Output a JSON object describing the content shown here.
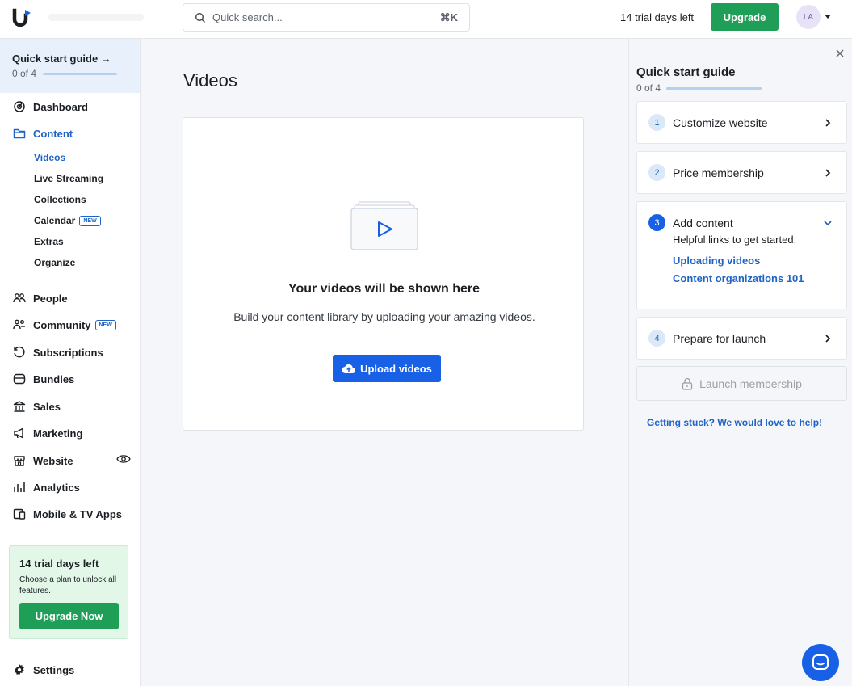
{
  "header": {
    "search_placeholder": "Quick search...",
    "search_shortcut": "⌘K",
    "trial_text": "14 trial days left",
    "upgrade_label": "Upgrade",
    "avatar_initials": "LA"
  },
  "sidebar": {
    "quick_start": {
      "title": "Quick start guide →",
      "progress": "0 of 4"
    },
    "nav": [
      {
        "label": "Dashboard",
        "icon": "dashboard-icon"
      },
      {
        "label": "Content",
        "icon": "folder-icon",
        "active": true
      },
      {
        "label": "People",
        "icon": "people-icon"
      },
      {
        "label": "Community",
        "icon": "community-icon",
        "badge": "NEW"
      },
      {
        "label": "Subscriptions",
        "icon": "refresh-icon"
      },
      {
        "label": "Bundles",
        "icon": "bundle-icon"
      },
      {
        "label": "Sales",
        "icon": "bank-icon"
      },
      {
        "label": "Marketing",
        "icon": "megaphone-icon"
      },
      {
        "label": "Website",
        "icon": "storefront-icon"
      },
      {
        "label": "Analytics",
        "icon": "analytics-icon"
      },
      {
        "label": "Mobile & TV Apps",
        "icon": "devices-icon"
      }
    ],
    "content_sub": [
      {
        "label": "Videos",
        "active": true
      },
      {
        "label": "Live Streaming"
      },
      {
        "label": "Collections"
      },
      {
        "label": "Calendar",
        "badge": "NEW"
      },
      {
        "label": "Extras"
      },
      {
        "label": "Organize"
      }
    ],
    "trial_card": {
      "title": "14 trial days left",
      "desc": "Choose a plan to unlock all features.",
      "button": "Upgrade Now"
    },
    "settings_label": "Settings"
  },
  "main": {
    "title": "Videos",
    "empty": {
      "title": "Your videos will be shown here",
      "desc": "Build your content library by uploading your amazing videos.",
      "button": "Upload videos"
    }
  },
  "quick_start_panel": {
    "title": "Quick start guide",
    "progress": "0 of 4",
    "steps": [
      {
        "num": "1",
        "label": "Customize website"
      },
      {
        "num": "2",
        "label": "Price membership"
      },
      {
        "num": "3",
        "label": "Add content",
        "sub": "Helpful links to get started:",
        "links": [
          "Uploading videos",
          "Content organizations 101"
        ]
      },
      {
        "num": "4",
        "label": "Prepare for launch"
      }
    ],
    "launch_label": "Launch membership",
    "help_link": "Getting stuck? We would love to help!"
  },
  "colors": {
    "accent": "#1861e6",
    "link": "#1f63c6",
    "success": "#1e9e57",
    "page_bg": "#f4f6f9"
  }
}
